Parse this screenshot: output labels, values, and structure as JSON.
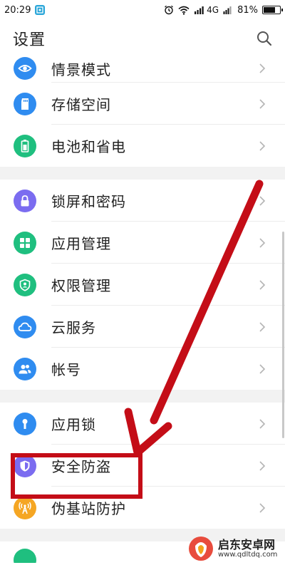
{
  "status_bar": {
    "time": "20:29",
    "network": "4G",
    "battery_text": "81%",
    "battery_level": 0.81
  },
  "header": {
    "title": "设置"
  },
  "groups": [
    {
      "items": [
        {
          "label": "情景模式",
          "icon": "eye-icon",
          "color": "#2f8cf0"
        },
        {
          "label": "存储空间",
          "icon": "sd-card-icon",
          "color": "#2f8cf0"
        },
        {
          "label": "电池和省电",
          "icon": "battery-icon",
          "color": "#1fbf7f"
        }
      ]
    },
    {
      "items": [
        {
          "label": "锁屏和密码",
          "icon": "lock-icon",
          "color": "#7b6cf0"
        },
        {
          "label": "应用管理",
          "icon": "grid-apps-icon",
          "color": "#1fbf7f"
        },
        {
          "label": "权限管理",
          "icon": "shield-user-icon",
          "color": "#1fbf7f"
        },
        {
          "label": "云服务",
          "icon": "cloud-icon",
          "color": "#2f8cf0"
        },
        {
          "label": "帐号",
          "icon": "users-icon",
          "color": "#2f8cf0"
        }
      ]
    },
    {
      "items": [
        {
          "label": "应用锁",
          "icon": "keyhole-icon",
          "color": "#2f8cf0"
        },
        {
          "label": "安全防盗",
          "icon": "shield-icon",
          "color": "#7b6cf0"
        },
        {
          "label": "伪基站防护",
          "icon": "signal-tower-icon",
          "color": "#f5a623"
        }
      ]
    }
  ],
  "watermark": {
    "name": "启东安卓网",
    "url": "www.qdltdq.com"
  },
  "colors": {
    "highlight": "#c40d17",
    "arrow": "#c40d17"
  }
}
